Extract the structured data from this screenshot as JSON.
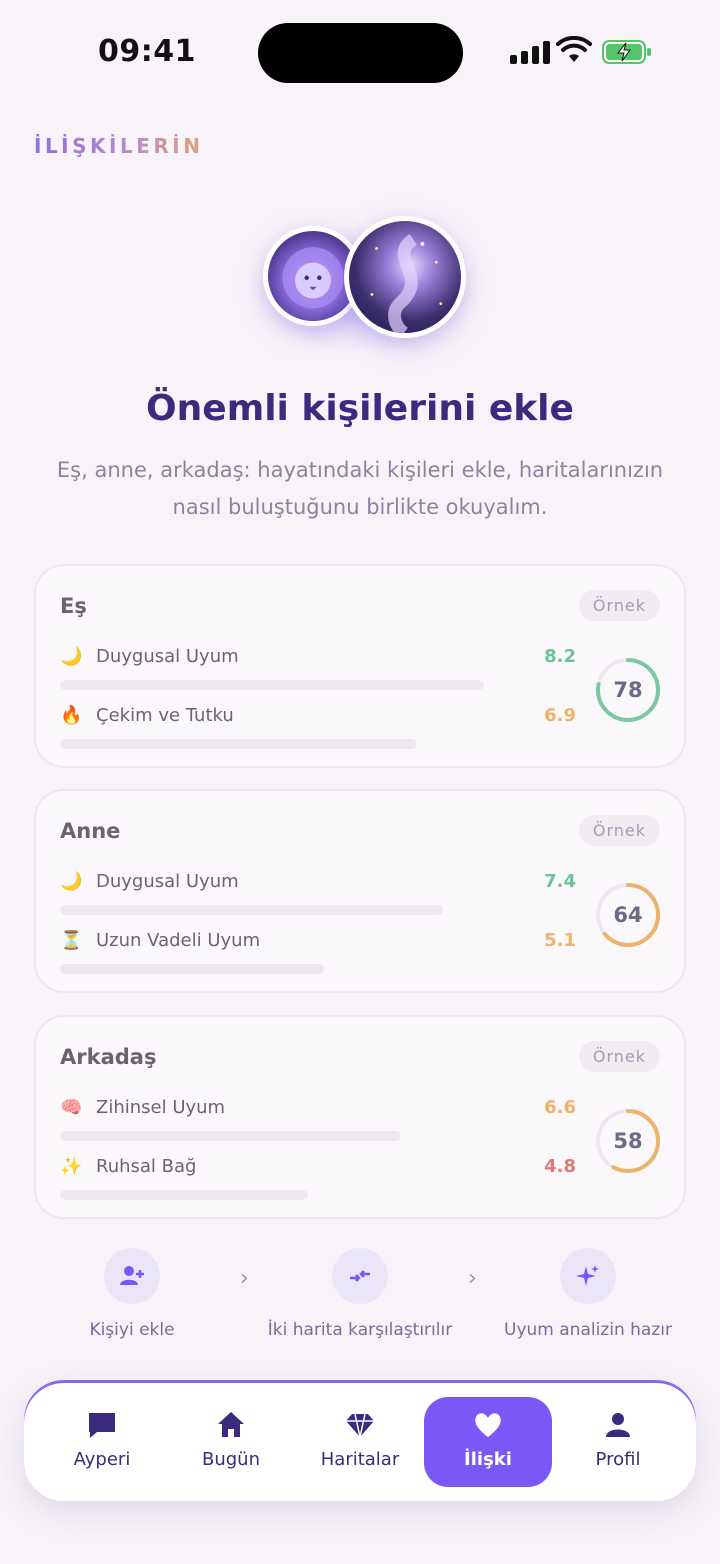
{
  "status_bar": {
    "time": "09:41"
  },
  "section_label": "İLİŞKİLERİN",
  "hero": {
    "title": "Önemli kişilerini ekle",
    "subtitle_line1": "Eş, anne, arkadaş: hayatındaki kişileri ekle, haritalarınızın",
    "subtitle_line2": "nasıl buluştuğunu birlikte okuyalım."
  },
  "cards": [
    {
      "title": "Eş",
      "badge": "Örnek",
      "score": "78",
      "score_fraction": 0.78,
      "ring_color": "#7cc8a2",
      "metrics": [
        {
          "emoji": "🌙",
          "label": "Duygusal Uyum",
          "value": "8.2",
          "color": "#6cc29a",
          "fill": 0.82
        },
        {
          "emoji": "🔥",
          "label": "Çekim ve Tutku",
          "value": "6.9",
          "color": "#ebb36b",
          "fill": 0.69
        }
      ]
    },
    {
      "title": "Anne",
      "badge": "Örnek",
      "score": "64",
      "score_fraction": 0.64,
      "ring_color": "#ebb36b",
      "metrics": [
        {
          "emoji": "🌙",
          "label": "Duygusal Uyum",
          "value": "7.4",
          "color": "#6cc29a",
          "fill": 0.74
        },
        {
          "emoji": "⏳",
          "label": "Uzun Vadeli Uyum",
          "value": "5.1",
          "color": "#ebb36b",
          "fill": 0.51
        }
      ]
    },
    {
      "title": "Arkadaş",
      "badge": "Örnek",
      "score": "58",
      "score_fraction": 0.58,
      "ring_color": "#ebb36b",
      "metrics": [
        {
          "emoji": "🧠",
          "label": "Zihinsel Uyum",
          "value": "6.6",
          "color": "#ebb36b",
          "fill": 0.66
        },
        {
          "emoji": "✨",
          "label": "Ruhsal Bağ",
          "value": "4.8",
          "color": "#e07a7a",
          "fill": 0.48
        }
      ]
    }
  ],
  "steps": [
    {
      "icon": "add-person-icon",
      "label": "Kişiyi ekle"
    },
    {
      "icon": "compare-arrows-icon",
      "label": "İki harita karşılaştırılır"
    },
    {
      "icon": "sparkles-icon",
      "label": "Uyum analizin hazır"
    }
  ],
  "tabs": [
    {
      "icon": "chat-bubble-icon",
      "label": "Ayperi",
      "active": false
    },
    {
      "icon": "home-icon",
      "label": "Bugün",
      "active": false
    },
    {
      "icon": "diamond-icon",
      "label": "Haritalar",
      "active": false
    },
    {
      "icon": "heart-icon",
      "label": "İlişki",
      "active": true
    },
    {
      "icon": "person-icon",
      "label": "Profil",
      "active": false
    }
  ],
  "colors": {
    "accent": "#7a58f6",
    "heading": "#3b2a7e",
    "background": "#f8f3f8"
  }
}
